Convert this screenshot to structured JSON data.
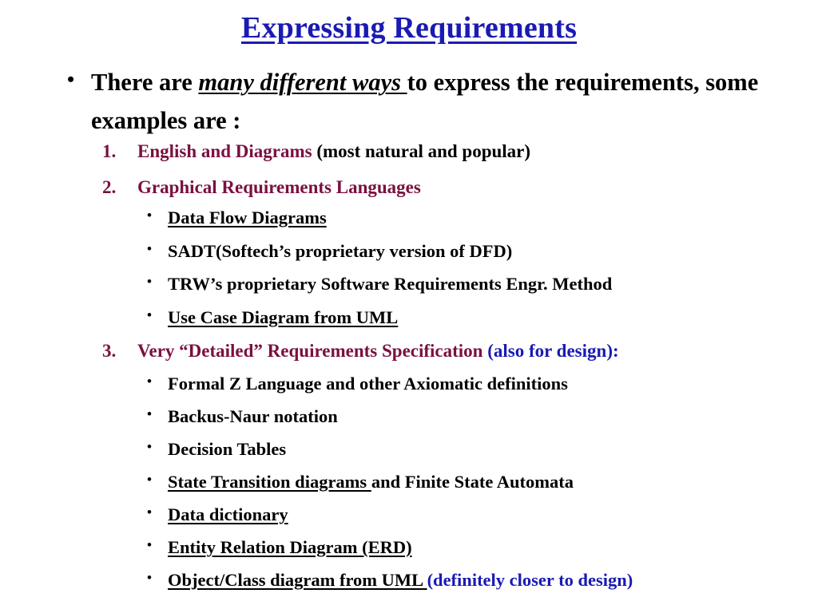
{
  "slide": {
    "title": "Expressing Requirements",
    "intro": {
      "bullet_glyph": "•",
      "part1": "There are ",
      "emphasis": "many different ways ",
      "part2": "to express the requirements, some examples are :"
    },
    "numbered": [
      {
        "marker": "1.",
        "label": "English and Diagrams",
        "note": " (most natural and popular)",
        "note_color": "#000000",
        "color": "#7a1040"
      },
      {
        "marker": "2.",
        "label": "Graphical Requirements Languages",
        "note": "",
        "note_color": "#000000",
        "color": "#7a1040"
      },
      {
        "marker": "3.",
        "label": "Very “Detailed” Requirements Specification",
        "note": " (also for design):",
        "note_color": "#1a1ab4",
        "color": "#7a1040"
      }
    ],
    "group_a": {
      "bullet_glyph": "•",
      "items": [
        {
          "underlined": "Data Flow Diagrams",
          "plain": "",
          "blue": ""
        },
        {
          "underlined": "",
          "plain": "SADT(Softech’s proprietary version of DFD)",
          "blue": ""
        },
        {
          "underlined": "",
          "plain": "TRW’s proprietary Software Requirements Engr. Method",
          "blue": ""
        },
        {
          "underlined": "Use Case Diagram  from UML",
          "plain": "",
          "blue": ""
        }
      ]
    },
    "group_b": {
      "bullet_glyph": "•",
      "items": [
        {
          "underlined": "",
          "plain": "Formal Z Language and other Axiomatic definitions",
          "blue": ""
        },
        {
          "underlined": "",
          "plain": "Backus-Naur notation",
          "blue": ""
        },
        {
          "underlined": "",
          "plain": "Decision Tables",
          "blue": ""
        },
        {
          "underlined": "State Transition diagrams ",
          "plain": "and Finite State Automata",
          "blue": ""
        },
        {
          "underlined": "Data dictionary",
          "plain": "",
          "blue": ""
        },
        {
          "underlined": "Entity Relation Diagram (ERD)",
          "plain": "",
          "blue": ""
        },
        {
          "underlined": "Object/Class diagram  from UML ",
          "plain": "",
          "blue": "(definitely closer to design)"
        }
      ]
    },
    "colors": {
      "title_blue": "#1a1ab4",
      "maroon": "#7a1040",
      "accent_blue": "#1a1ab4",
      "body_black": "#000000",
      "background": "#ffffff"
    }
  }
}
